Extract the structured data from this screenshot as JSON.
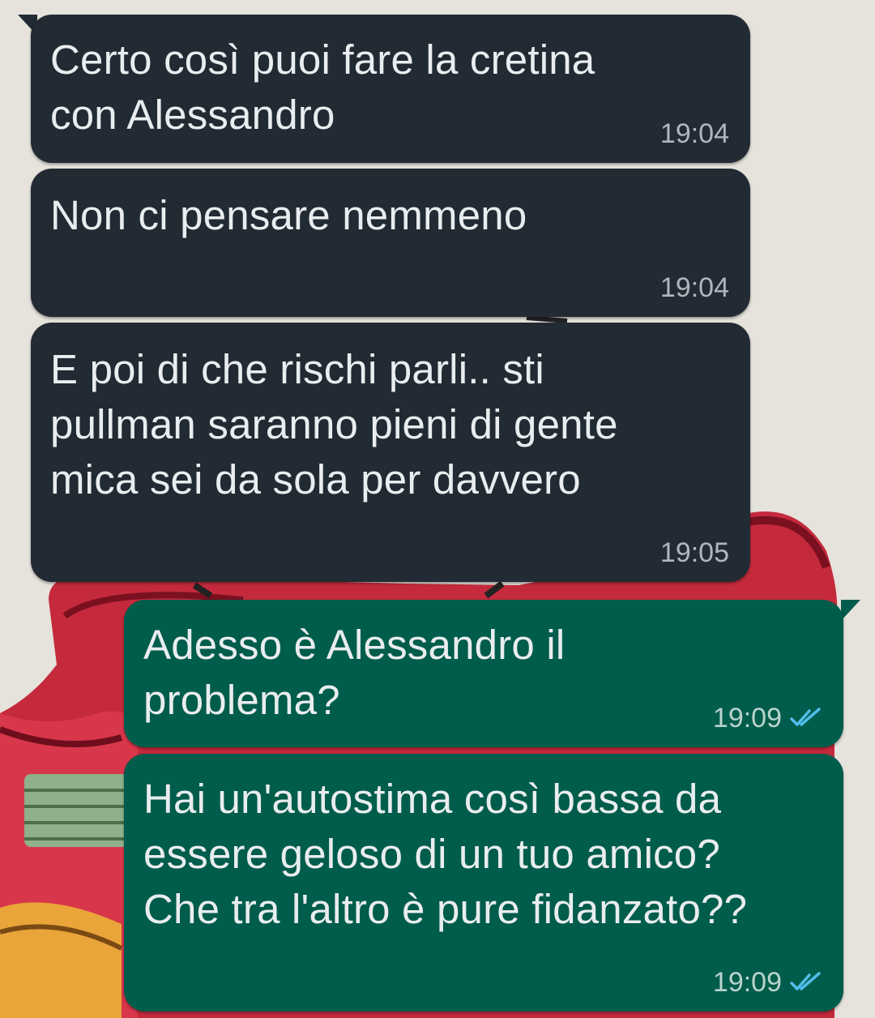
{
  "conversation": {
    "messages": [
      {
        "direction": "incoming",
        "text": "Certo così puoi fare la cretina\ncon Alessandro",
        "time": "19:04"
      },
      {
        "direction": "incoming",
        "text": "Non ci pensare nemmeno",
        "time": "19:04"
      },
      {
        "direction": "incoming",
        "text": "E poi di che rischi parli.. sti\npullman saranno pieni di gente\nmica sei da sola per davvero",
        "time": "19:05"
      },
      {
        "direction": "outgoing",
        "text": "Adesso è Alessandro il\nproblema?",
        "time": "19:09",
        "status": "read",
        "status_icon": "double-check-icon"
      },
      {
        "direction": "outgoing",
        "text": "Hai un'autostima così bassa da\nessere geloso di un tuo amico?\nChe tra l'altro è pure fidanzato??",
        "time": "19:09",
        "status": "read",
        "status_icon": "double-check-icon"
      }
    ]
  },
  "colors": {
    "incoming_bubble": "#222b33",
    "outgoing_bubble": "#005c4b",
    "text": "#e9edef",
    "read_ticks": "#53bdeb"
  }
}
